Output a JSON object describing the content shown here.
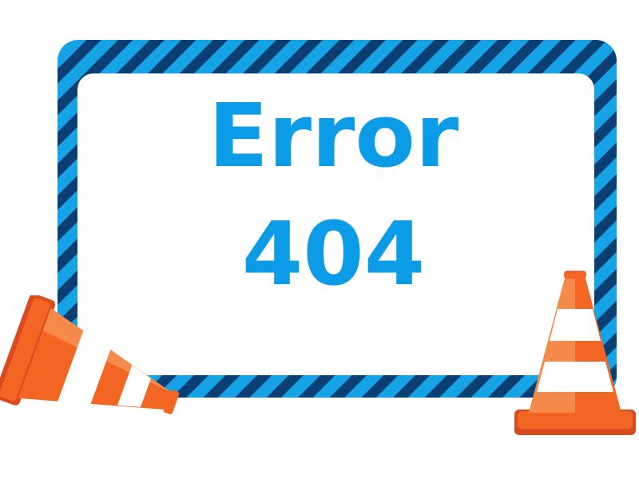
{
  "sign": {
    "line1": "Error",
    "line2": "404"
  },
  "colors": {
    "text_blue": "#0c9be6",
    "stripe_light": "#16a3e6",
    "stripe_dark": "#0a3f73",
    "cone_orange": "#f26522",
    "cone_dark": "#d94a1e",
    "cone_white": "#ffffff"
  },
  "icons": {
    "left": "traffic-cone-tipped-icon",
    "right": "traffic-cone-icon"
  }
}
